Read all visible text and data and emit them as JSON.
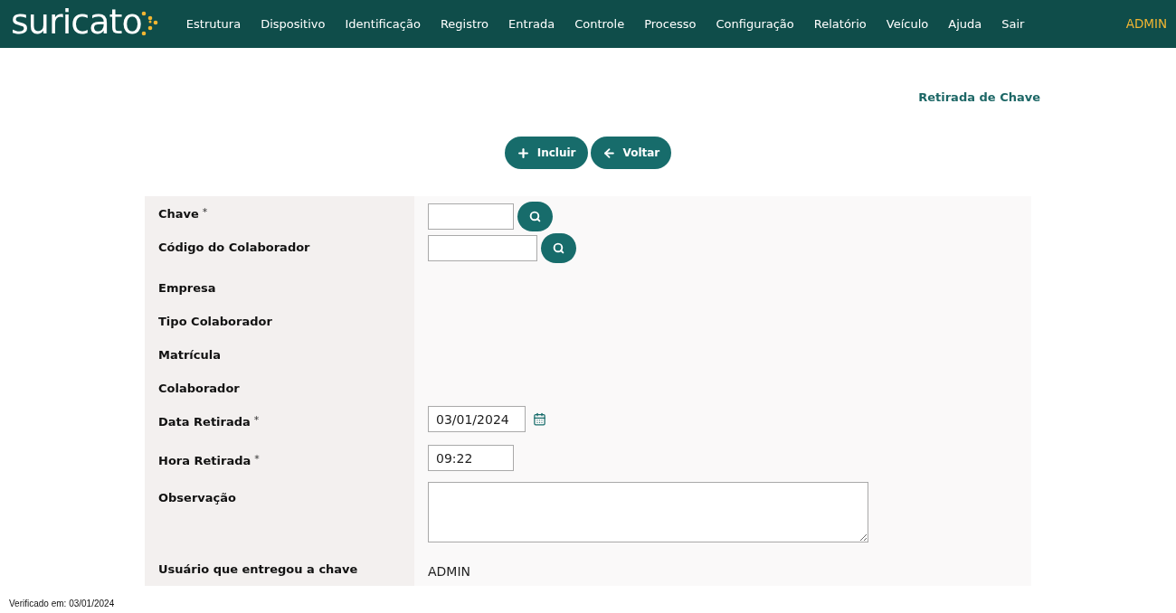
{
  "brand": {
    "name": "suricato"
  },
  "nav": {
    "items": [
      "Estrutura",
      "Dispositivo",
      "Identificação",
      "Registro",
      "Entrada",
      "Controle",
      "Processo",
      "Configuração",
      "Relatório",
      "Veículo",
      "Ajuda",
      "Sair"
    ],
    "user": "ADMIN"
  },
  "page_title": "Retirada de Chave",
  "actions": [
    {
      "kind": "add",
      "label": "Incluir"
    },
    {
      "kind": "back",
      "label": "Voltar"
    }
  ],
  "form": {
    "rows": [
      {
        "label": "Chave",
        "required_mark": "*",
        "kind": "search"
      },
      {
        "label": "Código do Colaborador",
        "kind": "search"
      },
      {
        "label": "Empresa",
        "kind": "empty"
      },
      {
        "label": "Tipo Colaborador",
        "kind": "empty"
      },
      {
        "label": "Matrícula",
        "kind": "empty"
      },
      {
        "label": "Colaborador",
        "kind": "empty"
      },
      {
        "label": "Data Retirada",
        "required_mark": "*",
        "kind": "date",
        "value": "03/01/2024"
      },
      {
        "label": "Hora Retirada",
        "required_mark": "*",
        "kind": "time",
        "value": "09:22"
      },
      {
        "label": "Observação",
        "kind": "textarea"
      },
      {
        "label": "Usuário que entregou a chave",
        "kind": "value",
        "value": "ADMIN"
      }
    ]
  },
  "footer": "Verificado em: 03/01/2024"
}
